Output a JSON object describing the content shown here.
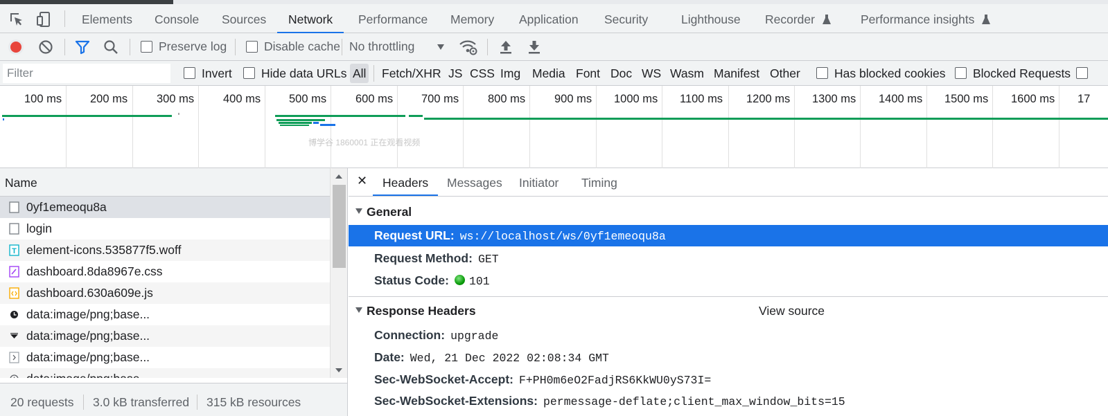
{
  "main_tabs": [
    "Elements",
    "Console",
    "Sources",
    "Network",
    "Performance",
    "Memory",
    "Application",
    "Security",
    "Lighthouse",
    "Recorder",
    "Performance insights"
  ],
  "active_tab": "Network",
  "toolbar": {
    "preserve_log": "Preserve log",
    "disable_cache": "Disable cache",
    "throttling": "No throttling"
  },
  "filterbar": {
    "placeholder": "Filter",
    "invert": "Invert",
    "hide_data_urls": "Hide data URLs",
    "types": [
      "All",
      "Fetch/XHR",
      "JS",
      "CSS",
      "Img",
      "Media",
      "Font",
      "Doc",
      "WS",
      "Wasm",
      "Manifest",
      "Other"
    ],
    "has_blocked_cookies": "Has blocked cookies",
    "blocked_requests": "Blocked Requests"
  },
  "timeline": {
    "ticks": [
      "100 ms",
      "200 ms",
      "300 ms",
      "400 ms",
      "500 ms",
      "600 ms",
      "700 ms",
      "800 ms",
      "900 ms",
      "1000 ms",
      "1100 ms",
      "1200 ms",
      "1300 ms",
      "1400 ms",
      "1500 ms",
      "1600 ms",
      "17"
    ],
    "watermark": "博学谷 1860001 正在观看视频"
  },
  "requests": {
    "column_name": "Name",
    "rows": [
      {
        "name": "0yf1emeoqu8a",
        "icon": "document-icon"
      },
      {
        "name": "login",
        "icon": "document-icon"
      },
      {
        "name": "element-icons.535877f5.woff",
        "icon": "font-file-icon"
      },
      {
        "name": "dashboard.8da8967e.css",
        "icon": "stylesheet-file-icon"
      },
      {
        "name": "dashboard.630a609e.js",
        "icon": "script-file-icon"
      },
      {
        "name": "data:image/png;base...",
        "icon": "clock-image-icon"
      },
      {
        "name": "data:image/png;base...",
        "icon": "caret-image-icon"
      },
      {
        "name": "data:image/png;base...",
        "icon": "chevron-image-icon"
      },
      {
        "name": "data:image/png;base...",
        "icon": "plus-image-icon"
      }
    ],
    "status": {
      "count": "20 requests",
      "transferred": "3.0 kB transferred",
      "resources": "315 kB resources"
    }
  },
  "details": {
    "tabs": [
      "Headers",
      "Messages",
      "Initiator",
      "Timing"
    ],
    "active_tab": "Headers",
    "general": {
      "title": "General",
      "request_url_key": "Request URL:",
      "request_url": "ws://localhost/ws/0yf1emeoqu8a",
      "request_method_key": "Request Method:",
      "request_method": "GET",
      "status_code_key": "Status Code:",
      "status_code": "101"
    },
    "response_headers": {
      "title": "Response Headers",
      "view_source": "View source",
      "items": [
        {
          "key": "Connection:",
          "value": "upgrade"
        },
        {
          "key": "Date:",
          "value": "Wed, 21 Dec 2022 02:08:34 GMT"
        },
        {
          "key": "Sec-WebSocket-Accept:",
          "value": "F+PH0m6eO2FadjRS6KkWU0yS73I="
        },
        {
          "key": "Sec-WebSocket-Extensions:",
          "value": "permessage-deflate;client_max_window_bits=15"
        }
      ]
    }
  },
  "colors": {
    "accent": "#1a73e8",
    "record": "#e8453c",
    "timeline_green": "#0f9d58",
    "status_green": "#0a9b0a"
  }
}
